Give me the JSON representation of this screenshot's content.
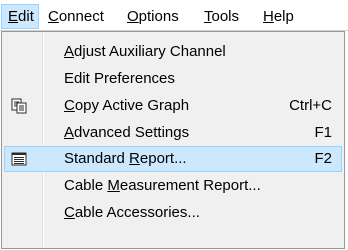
{
  "menubar": {
    "items": [
      {
        "pre": "",
        "key": "E",
        "post": "dit"
      },
      {
        "pre": "",
        "key": "C",
        "post": "onnect"
      },
      {
        "pre": "",
        "key": "O",
        "post": "ptions"
      },
      {
        "pre": "",
        "key": "T",
        "post": "ools"
      },
      {
        "pre": "",
        "key": "H",
        "post": "elp"
      }
    ],
    "active_index": 0
  },
  "edit_menu": {
    "items": [
      {
        "pre": "",
        "key": "A",
        "post": "djust Auxiliary Channel",
        "shortcut": "",
        "icon": ""
      },
      {
        "pre": "Edit Preferences",
        "key": "",
        "post": "",
        "shortcut": "",
        "icon": ""
      },
      {
        "pre": "",
        "key": "C",
        "post": "opy Active Graph",
        "shortcut": "Ctrl+C",
        "icon": "copy-icon"
      },
      {
        "pre": "",
        "key": "A",
        "post": "dvanced Settings",
        "shortcut": "F1",
        "icon": ""
      },
      {
        "pre": "Standard ",
        "key": "R",
        "post": "eport...",
        "shortcut": "F2",
        "icon": "report-icon"
      },
      {
        "pre": "Cable ",
        "key": "M",
        "post": "easurement Report...",
        "shortcut": "",
        "icon": ""
      },
      {
        "pre": "",
        "key": "C",
        "post": "able Accessories...",
        "shortcut": "",
        "icon": ""
      }
    ],
    "highlighted_index": 4
  },
  "colors": {
    "highlight_fill": "#cce8ff",
    "highlight_border": "#99d1ff",
    "menu_background": "#f0f0f0"
  }
}
